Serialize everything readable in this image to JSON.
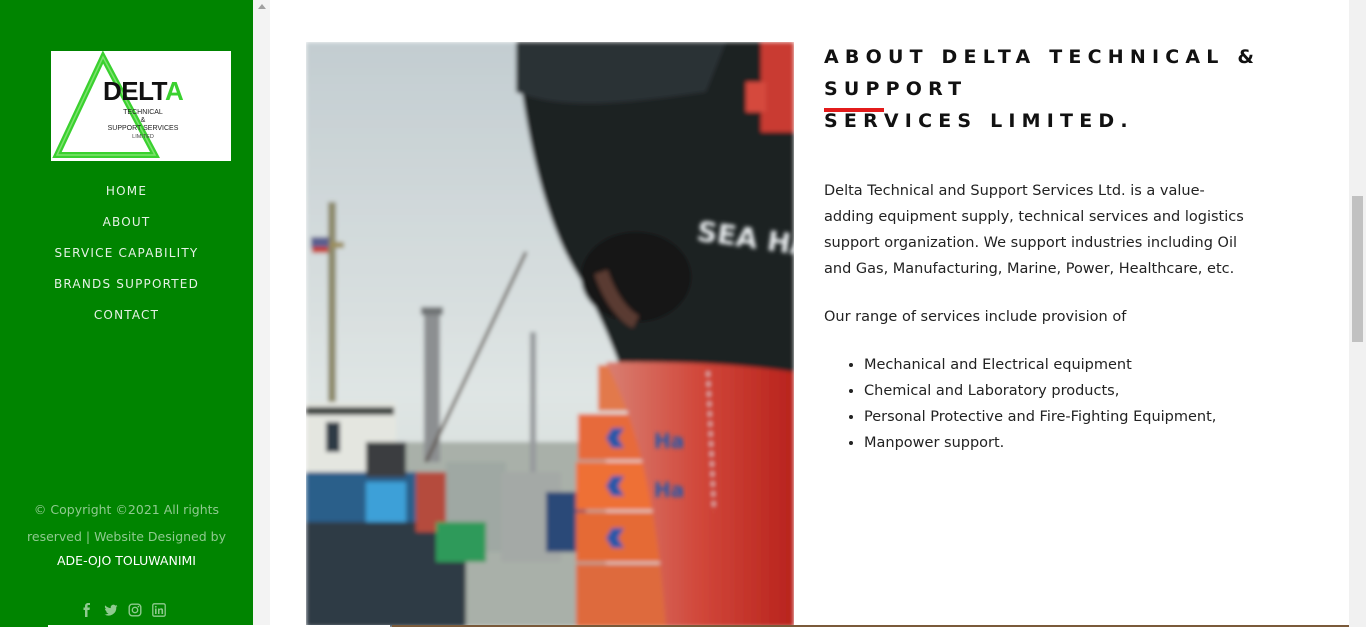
{
  "logo": {
    "word": "DELT",
    "word_accent": "A",
    "sub_line1": "TECHNICAL",
    "sub_line2": "&",
    "sub_line3": "SUPPORT SERVICES",
    "sub_line4": "LIMITED"
  },
  "nav": {
    "items": [
      "HOME",
      "ABOUT",
      "SERVICE CAPABILITY",
      "BRANDS SUPPORTED",
      "CONTACT"
    ]
  },
  "footer": {
    "copyright_line1": "© Copyright ©2021 All rights",
    "copyright_line2": "reserved | Website Designed by",
    "designer": "ADE-OJO TOLUWANIMI",
    "social_icons": [
      "facebook-icon",
      "twitter-icon",
      "instagram-icon",
      "linkedin-icon"
    ]
  },
  "photo": {
    "ship_name": "SEA HA",
    "container_text": "Ha"
  },
  "about": {
    "heading_line1": "ABOUT DELTA TECHNICAL & SUPPORT",
    "heading_line2": "SERVICES LIMITED.",
    "paragraph1": "Delta Technical and Support Services Ltd. is a value-adding equipment supply, technical services and logistics support organization. We support industries including Oil and Gas, Manufacturing, Marine, Power, Healthcare, etc.",
    "paragraph2": "Our range of services include provision of",
    "services": [
      "Mechanical and Electrical equipment",
      "Chemical and Laboratory products,",
      "Personal Protective and Fire-Fighting Equipment,",
      "Manpower support."
    ]
  },
  "colors": {
    "sidebar": "#008400",
    "accent_red": "#e31b1b",
    "logo_green": "#3ad12f"
  }
}
